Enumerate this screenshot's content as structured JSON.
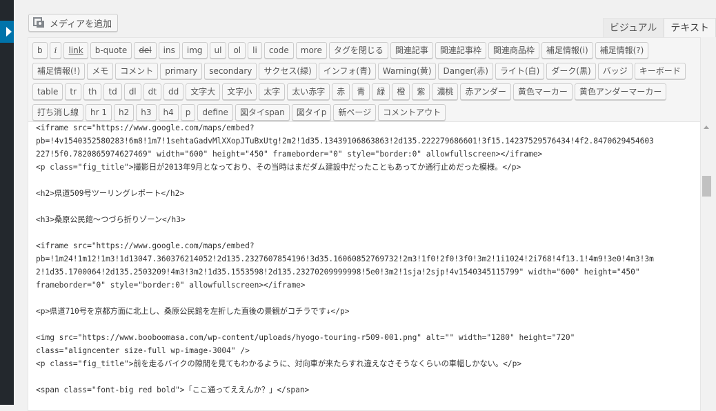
{
  "media_button": {
    "label": "メディアを追加",
    "icon": "media-icon"
  },
  "tabs": [
    "ビジュアル",
    "テキスト"
  ],
  "toolbar": {
    "rows": [
      [
        "b",
        "i",
        "link",
        "b-quote",
        "del",
        "ins",
        "img",
        "ul",
        "ol",
        "li",
        "code",
        "more",
        "タグを閉じる",
        "関連記事",
        "関連記事枠",
        "関連商品枠",
        "補足情報(i)"
      ],
      [
        "補足情報(?)",
        "補足情報(!)",
        "メモ",
        "コメント",
        "primary",
        "secondary",
        "サクセス(緑)",
        "インフォ(青)",
        "Warning(黄)",
        "Danger(赤)",
        "ライト(白)",
        "ダーク(黒)"
      ],
      [
        "バッジ",
        "キーボード",
        "table",
        "tr",
        "th",
        "td",
        "dl",
        "dt",
        "dd",
        "文字大",
        "文字小",
        "太字",
        "太い赤字",
        "赤",
        "青",
        "緑",
        "橙",
        "紫",
        "濃桃",
        "赤アンダー"
      ],
      [
        "黄色マーカー",
        "黄色アンダーマーカー",
        "打ち消し線",
        "hr 1",
        "h2",
        "h3",
        "h4",
        "p",
        "define",
        "図タイspan",
        "図タイp",
        "新ページ",
        "コメントアウト"
      ]
    ]
  },
  "editor": {
    "lines": [
      "<iframe src=\"https://www.google.com/maps/embed?",
      "pb=!4v1540352580283!6m8!1m7!1sehtaGadvMlXXopJTuBxUtg!2m2!1d35.13439106863863!2d135.222279686601!3f15.14237529576434!4f2.8470629454603",
      "227!5f0.7820865974627469\" width=\"600\" height=\"450\" frameborder=\"0\" style=\"border:0\" allowfullscreen></iframe>",
      "<p class=\"fig_title\">撮影日が2013年9月となっており、その当時はまだダム建設中だったこともあってか通行止めだった模様。</p>",
      "",
      "<h2>県道509号ツーリングレポート</h2>",
      "",
      "<h3>桑原公民館～つづら折りゾーン</h3>",
      "",
      "<iframe src=\"https://www.google.com/maps/embed?",
      "pb=!1m24!1m12!1m3!1d13047.360376214052!2d135.2327607854196!3d35.16060852769732!2m3!1f0!2f0!3f0!3m2!1i1024!2i768!4f13.1!4m9!3e0!4m3!3m",
      "2!1d35.1700064!2d135.2503209!4m3!3m2!1d35.1553598!2d135.23270209999998!5e0!3m2!1sja!2sjp!4v1540345115799\" width=\"600\" height=\"450\"",
      "frameborder=\"0\" style=\"border:0\" allowfullscreen></iframe>",
      "",
      "<p>県道710号を京都方面に北上し、桑原公民館を左折した直後の景観がコチラです↓</p>",
      "",
      "<img src=\"https://www.booboomasa.com/wp-content/uploads/hyogo-touring-r509-001.png\" alt=\"\" width=\"1280\" height=\"720\"",
      "class=\"aligncenter size-full wp-image-3004\" />",
      "<p class=\"fig_title\">前を走るバイクの隙間を見てもわかるように、対向車が来たらすれ違えなさそうなくらいの車幅しかない。</p>",
      "",
      "<span class=\"font-big red bold\">「ここ通ってええんか？」</span>"
    ]
  }
}
